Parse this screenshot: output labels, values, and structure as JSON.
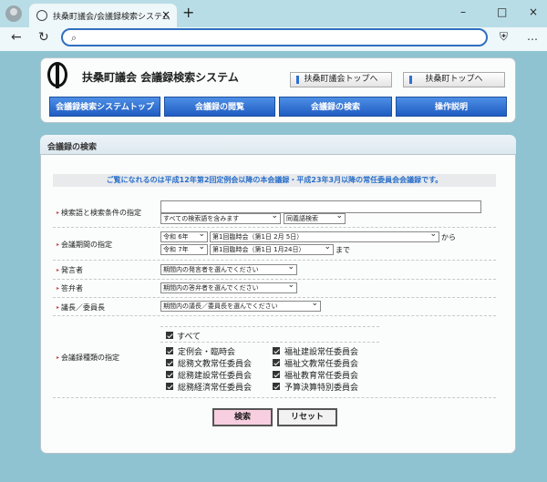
{
  "browser": {
    "tab_title": "扶桑町議会/会議録検索システム",
    "new_tab_symbol": "+",
    "close_symbol": "×",
    "back_symbol": "←",
    "reload_symbol": "↻",
    "search_symbol": "⌕",
    "minimize_symbol": "–",
    "maximize_symbol": "□",
    "window_close_symbol": "×",
    "more_symbol": "…",
    "shield_symbol": "⛨"
  },
  "header": {
    "site_title": "扶桑町議会 会議録検索システム",
    "top_links": [
      "扶桑町議会トップへ",
      "扶桑町トップへ"
    ],
    "menu": [
      "会議録検索システムトップ",
      "会議録の閲覧",
      "会議録の検索",
      "操作説明"
    ]
  },
  "search": {
    "section_title": "会議録の検索",
    "notice": "ご覧になれるのは平成12年第2回定例会以降の本会議録・平成23年3月以降の常任委員会会議録です。",
    "keyword": {
      "label": "検索語と検索条件の指定",
      "value": "",
      "condition": "すべての検索語を含みます",
      "mode": "同義語検索"
    },
    "period": {
      "label": "会議期間の指定",
      "from_year": "令和 6年",
      "from_session": "第1回臨時会（第1日 2月 5日）",
      "from_suffix": "から",
      "to_year": "令和 7年",
      "to_session": "第1回臨時会（第1日 1月24日）",
      "to_suffix": "まで"
    },
    "speaker": {
      "label": "発言者",
      "value": "期間内の発言者を選んでください"
    },
    "respondent": {
      "label": "答弁者",
      "value": "期間内の答弁者を選んでください"
    },
    "chair": {
      "label": "議長／委員長",
      "value": "期間内の議長／委員長を選んでください"
    },
    "meeting_types": {
      "label": "会議録種類の指定",
      "all_label": "すべて",
      "all_checked": true,
      "items": [
        {
          "label": "定例会・臨時会",
          "checked": true
        },
        {
          "label": "総務文教常任委員会",
          "checked": true
        },
        {
          "label": "総務建設常任委員会",
          "checked": true
        },
        {
          "label": "総務経済常任委員会",
          "checked": true
        },
        {
          "label": "福祉建設常任委員会",
          "checked": true
        },
        {
          "label": "福祉文教常任委員会",
          "checked": true
        },
        {
          "label": "福祉教育常任委員会",
          "checked": true
        },
        {
          "label": "予算決算特別委員会",
          "checked": true
        }
      ]
    },
    "buttons": {
      "search": "検索",
      "reset": "リセット"
    }
  },
  "colors": {
    "accent": "#2f6fd0",
    "menu_blue": "#1f5cc1",
    "search_button": "#f8cfe0",
    "notice_text": "#2a6fc9"
  }
}
